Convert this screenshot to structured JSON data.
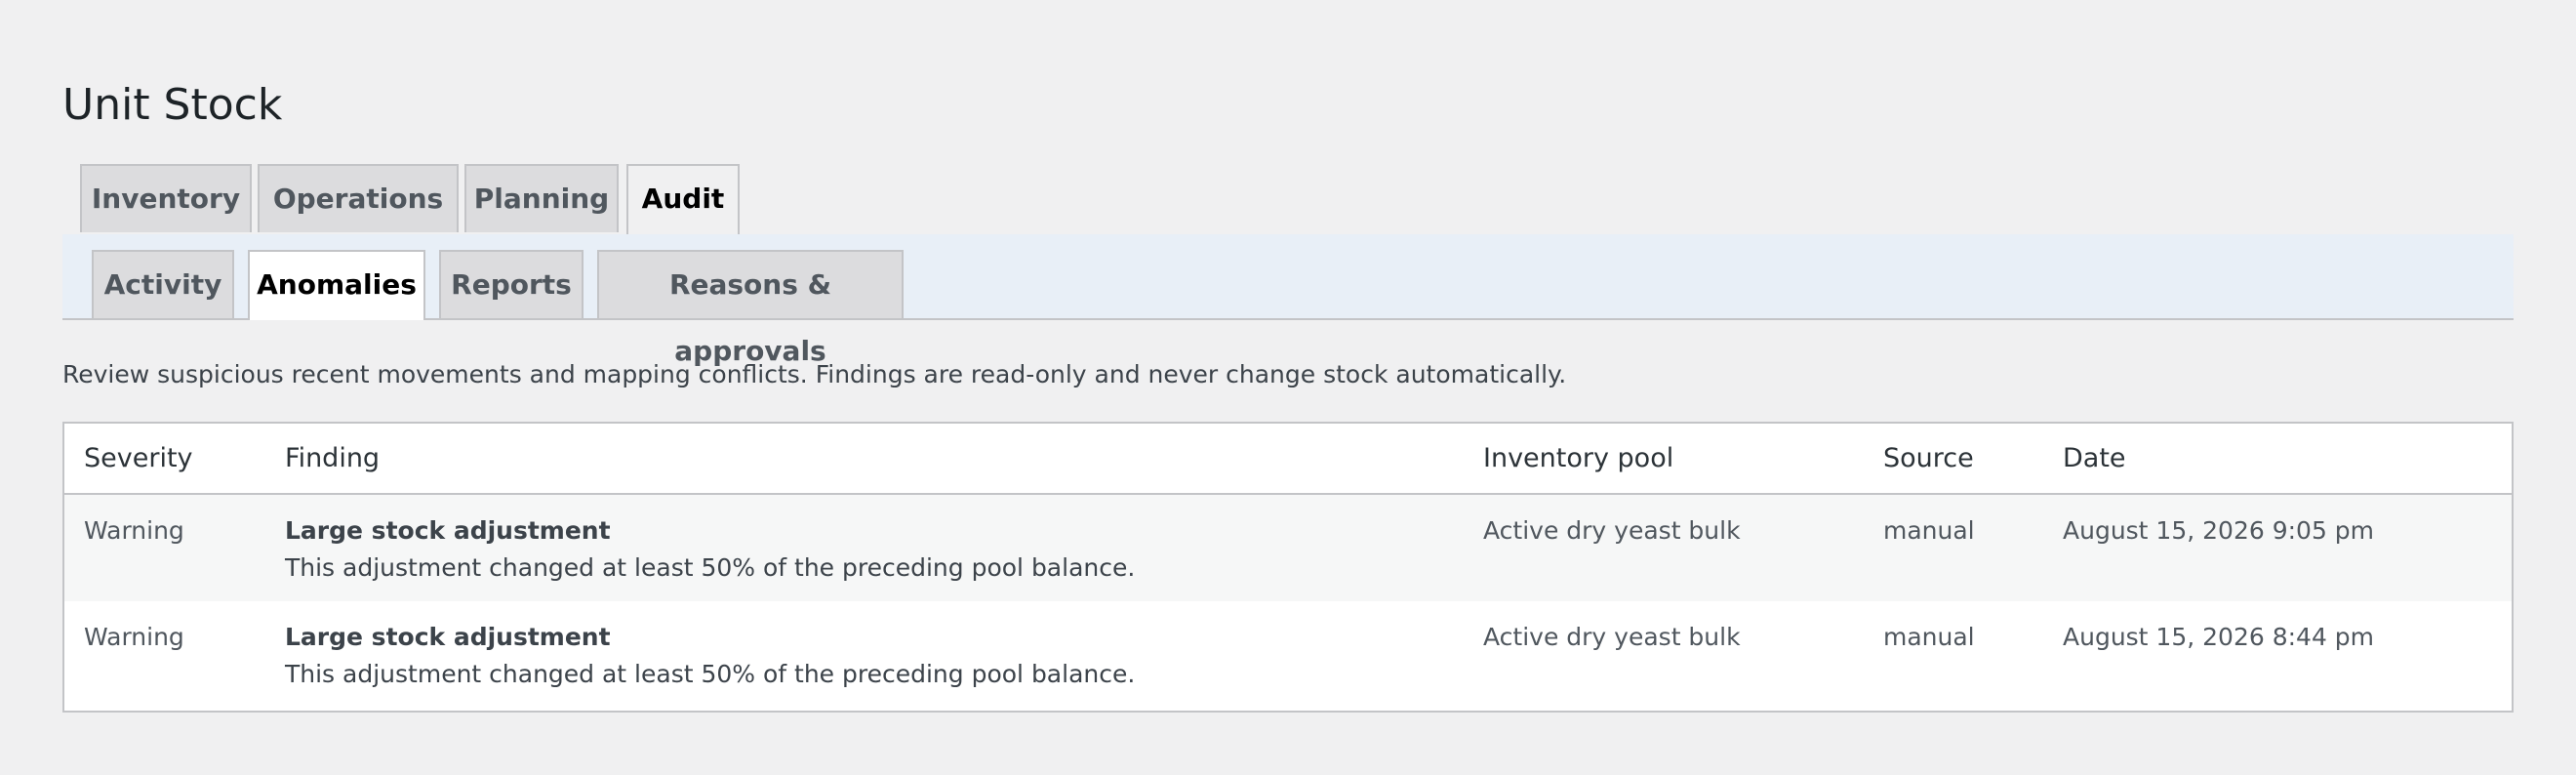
{
  "page": {
    "title": "Unit Stock",
    "description": "Review suspicious recent movements and mapping conflicts. Findings are read-only and never change stock automatically."
  },
  "main_tabs": [
    {
      "label": "Inventory",
      "active": false
    },
    {
      "label": "Operations",
      "active": false
    },
    {
      "label": "Planning",
      "active": false
    },
    {
      "label": "Audit",
      "active": true
    }
  ],
  "sub_tabs": [
    {
      "label": "Activity",
      "active": false
    },
    {
      "label": "Anomalies",
      "active": true
    },
    {
      "label": "Reports",
      "active": false
    },
    {
      "label": "Reasons & approvals",
      "active": false
    }
  ],
  "table": {
    "headers": [
      "Severity",
      "Finding",
      "Inventory pool",
      "Source",
      "Date"
    ],
    "rows": [
      {
        "severity": "Warning",
        "finding_title": "Large stock adjustment",
        "finding_desc": "This adjustment changed at least 50% of the preceding pool balance.",
        "pool": "Active dry yeast bulk",
        "source": "manual",
        "date": "August 15, 2026 9:05 pm"
      },
      {
        "severity": "Warning",
        "finding_title": "Large stock adjustment",
        "finding_desc": "This adjustment changed at least 50% of the preceding pool balance.",
        "pool": "Active dry yeast bulk",
        "source": "manual",
        "date": "August 15, 2026 8:44 pm"
      }
    ]
  },
  "colors": {
    "background": "#f0f0f1",
    "tab_inactive": "#dcdcde",
    "subtab_bar": "#e8eff7",
    "border": "#c3c4c7",
    "row_alt": "#f6f7f7"
  }
}
